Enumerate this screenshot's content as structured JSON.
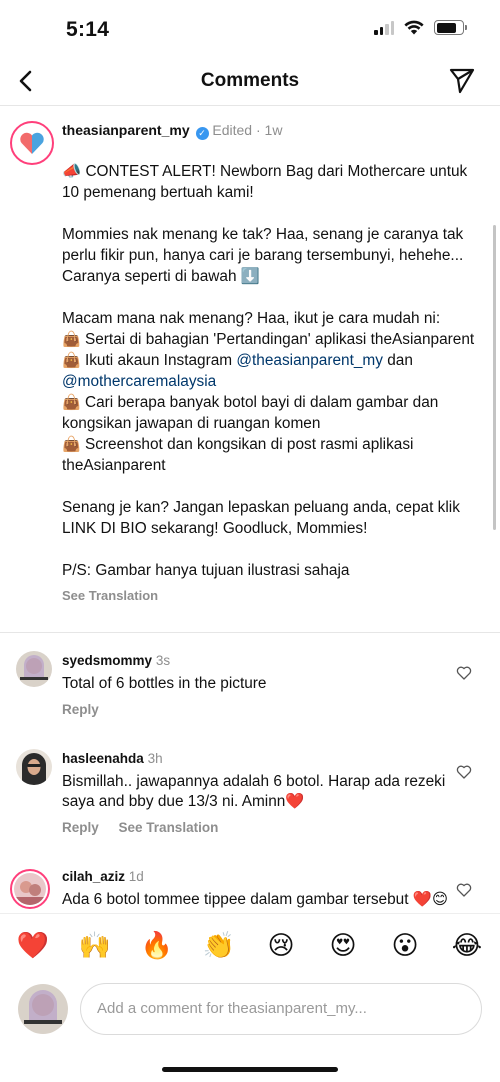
{
  "status": {
    "time": "5:14"
  },
  "header": {
    "title": "Comments"
  },
  "post": {
    "username": "theasianparent_my",
    "edited": "Edited",
    "separator": "·",
    "time": "1w",
    "p1": "📣 CONTEST ALERT! Newborn Bag dari Mothercare untuk 10 pemenang bertuah kami!",
    "p2": "Mommies nak menang ke tak? Haa, senang je caranya tak perlu fikir pun, hanya cari je barang tersembunyi, hehehe... Caranya seperti di bawah ⬇️",
    "p3_intro": "Macam mana nak menang? Haa, ikut je cara mudah ni:",
    "bag_emoji": "👜",
    "step1": " Sertai di bahagian 'Pertandingan' aplikasi theAsianparent",
    "step2_a": " Ikuti akaun Instagram ",
    "step2_mention1": "@theasianparent_my",
    "step2_b": " dan ",
    "step2_mention2": "@mothercaremalaysia",
    "step3": " Cari berapa banyak botol bayi di dalam gambar dan kongsikan jawapan di ruangan komen",
    "step4": " Screenshot dan kongsikan di post rasmi aplikasi theAsianparent",
    "p4": "Senang je kan? Jangan lepaskan peluang anda, cepat klik LINK DI BIO sekarang! Goodluck, Mommies!",
    "p5": "P/S: Gambar hanya tujuan ilustrasi sahaja",
    "see_translation": "See Translation"
  },
  "comments": [
    {
      "username": "syedsmommy",
      "time": "3s",
      "text": "Total of 6 bottles in the picture",
      "reply": "Reply"
    },
    {
      "username": "hasleenahda",
      "time": "3h",
      "text": "Bismillah.. jawapannya adalah 6 botol. Harap ada rezeki saya and bby due 13/3 ni. Aminn❤️",
      "reply": "Reply",
      "see_translation": "See Translation"
    },
    {
      "username": "cilah_aziz",
      "time": "1d",
      "text": "Ada 6 botol tommee tippee dalam gambar tersebut ❤️😊"
    }
  ],
  "reactions": [
    "❤️",
    "🙌",
    "🔥",
    "👏",
    "😢",
    "😍",
    "😮",
    "😂"
  ],
  "composer": {
    "placeholder": "Add a comment for theasianparent_my..."
  },
  "colors": {
    "mention": "#00376b",
    "muted": "#8e8e8e",
    "verified": "#3897f0"
  }
}
